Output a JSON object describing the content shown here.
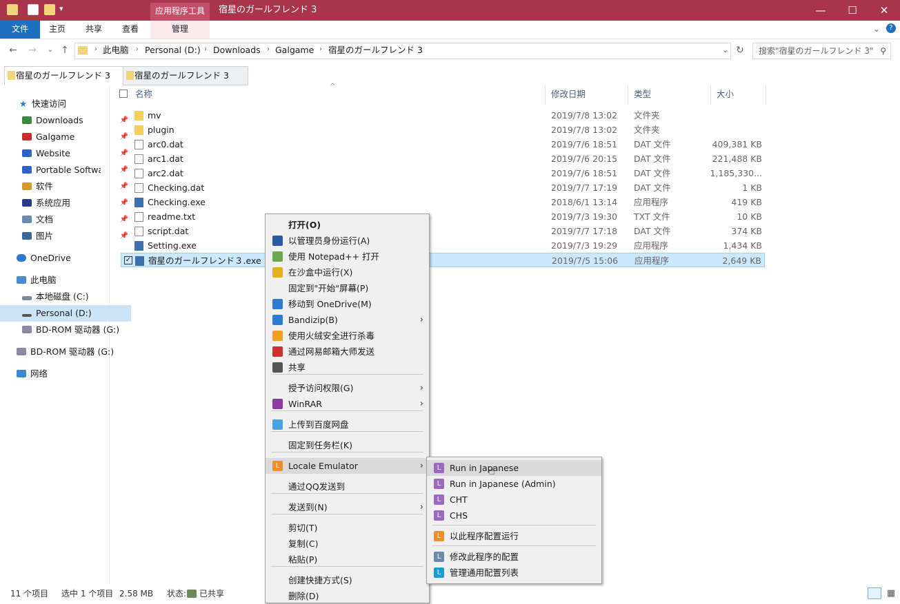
{
  "window": {
    "title": "宿星のガールフレンド 3",
    "contextual_tab_group": "应用程序工具",
    "controls": [
      "—",
      "☐",
      "✕"
    ]
  },
  "ribbon": {
    "tabs": [
      "文件",
      "主页",
      "共享",
      "查看",
      "管理"
    ]
  },
  "address_bar": {
    "crumbs": [
      "此电脑",
      "Personal (D:)",
      "Downloads",
      "Galgame",
      "宿星のガールフレンド 3"
    ],
    "search_placeholder": "搜索\"宿星のガールフレンド 3\""
  },
  "folder_tabs": [
    "宿星のガールフレンド 3",
    "宿星のガールフレンド 3"
  ],
  "nav_pane": {
    "quick_access": "快速访问",
    "items": [
      {
        "label": "Downloads",
        "color": "#3a8a3a",
        "pinned": true
      },
      {
        "label": "Galgame",
        "color": "#c83030",
        "pinned": true
      },
      {
        "label": "Website",
        "color": "#2d64c8",
        "pinned": true
      },
      {
        "label": "Portable Software",
        "color": "#2d64c8",
        "pinned": true
      },
      {
        "label": "软件",
        "color": "#d69a2a",
        "pinned": true
      },
      {
        "label": "系统应用",
        "color": "#2a3a8a",
        "pinned": true
      },
      {
        "label": "文档",
        "color": "#6a8ab0",
        "pinned": true
      },
      {
        "label": "图片",
        "color": "#3a6a9a",
        "pinned": true
      }
    ],
    "onedrive": "OneDrive",
    "this_pc": "此电脑",
    "drives": [
      "本地磁盘 (C:)",
      "Personal (D:)",
      "BD-ROM 驱动器 (G:)"
    ],
    "bd_rom": "BD-ROM 驱动器 (G:)",
    "network": "网络"
  },
  "columns": {
    "name": "名称",
    "date": "修改日期",
    "type": "类型",
    "size": "大小"
  },
  "files": [
    {
      "name": "mv",
      "date": "2019/7/8 13:02",
      "type": "文件夹",
      "size": "",
      "kind": "folder"
    },
    {
      "name": "plugin",
      "date": "2019/7/8 13:02",
      "type": "文件夹",
      "size": "",
      "kind": "folder"
    },
    {
      "name": "arc0.dat",
      "date": "2019/7/6 18:51",
      "type": "DAT 文件",
      "size": "409,381 KB",
      "kind": "file"
    },
    {
      "name": "arc1.dat",
      "date": "2019/7/6 20:15",
      "type": "DAT 文件",
      "size": "221,488 KB",
      "kind": "file"
    },
    {
      "name": "arc2.dat",
      "date": "2019/7/6 18:51",
      "type": "DAT 文件",
      "size": "1,185,330...",
      "kind": "file"
    },
    {
      "name": "Checking.dat",
      "date": "2019/7/7 17:19",
      "type": "DAT 文件",
      "size": "1 KB",
      "kind": "file"
    },
    {
      "name": "Checking.exe",
      "date": "2018/6/1 13:14",
      "type": "应用程序",
      "size": "419 KB",
      "kind": "exe"
    },
    {
      "name": "readme.txt",
      "date": "2019/7/3 19:30",
      "type": "TXT 文件",
      "size": "10 KB",
      "kind": "txt"
    },
    {
      "name": "script.dat",
      "date": "2019/7/7 17:18",
      "type": "DAT 文件",
      "size": "374 KB",
      "kind": "file"
    },
    {
      "name": "Setting.exe",
      "date": "2019/7/3 19:29",
      "type": "应用程序",
      "size": "1,434 KB",
      "kind": "exe"
    },
    {
      "name": "宿星のガールフレンド３.exe",
      "date": "2019/7/5 15:06",
      "type": "应用程序",
      "size": "2,649 KB",
      "kind": "exe"
    }
  ],
  "context_menu": {
    "items": [
      {
        "label": "打开(O)",
        "bold": true
      },
      {
        "label": "以管理员身份运行(A)",
        "icon": "#2c5aa0"
      },
      {
        "label": "使用 Notepad++ 打开",
        "icon": "#6aa84f"
      },
      {
        "label": "在沙盒中运行(X)",
        "icon": "#e3b020"
      },
      {
        "label": "固定到\"开始\"屏幕(P)"
      },
      {
        "label": "移动到 OneDrive(M)",
        "icon": "#2b7cd3"
      },
      {
        "label": "Bandizip(B)",
        "icon": "#2b7cd3",
        "submenu": true
      },
      {
        "label": "使用火绒安全进行杀毒",
        "icon": "#f0a020"
      },
      {
        "label": "通过网易邮箱大师发送",
        "icon": "#d03030"
      },
      {
        "label": "共享",
        "icon": "#555555"
      },
      {
        "label": "授予访问权限(G)",
        "submenu": true
      },
      {
        "label": "WinRAR",
        "icon": "#8a3aa0",
        "submenu": true
      },
      {
        "label": "上传到百度网盘",
        "icon": "#4aa3df"
      },
      {
        "label": "固定到任务栏(K)"
      },
      {
        "label": "Locale Emulator",
        "icon": "#f0901e",
        "submenu": true,
        "highlight": true
      },
      {
        "label": "通过QQ发送到"
      },
      {
        "label": "发送到(N)",
        "submenu": true
      },
      {
        "label": "剪切(T)"
      },
      {
        "label": "复制(C)"
      },
      {
        "label": "粘贴(P)"
      },
      {
        "label": "创建快捷方式(S)"
      },
      {
        "label": "删除(D)"
      }
    ]
  },
  "submenu": {
    "items": [
      {
        "label": "Run in Japanese",
        "icon": "#9a6ac0",
        "highlight": true
      },
      {
        "label": "Run in Japanese (Admin)",
        "icon": "#9a6ac0"
      },
      {
        "label": "CHT",
        "icon": "#9a6ac0"
      },
      {
        "label": "CHS",
        "icon": "#9a6ac0"
      },
      {
        "label": "以此程序配置运行",
        "icon": "#f0901e"
      },
      {
        "label": "修改此程序的配置",
        "icon": "#6a8ab0"
      },
      {
        "label": "管理通用配置列表",
        "icon": "#1e9ad0"
      }
    ],
    "icon_letter": "L"
  },
  "status": {
    "items": "11 个项目",
    "selected": "选中 1 个项目",
    "size": "2.58 MB",
    "state": "状态:",
    "shared": "已共享"
  }
}
